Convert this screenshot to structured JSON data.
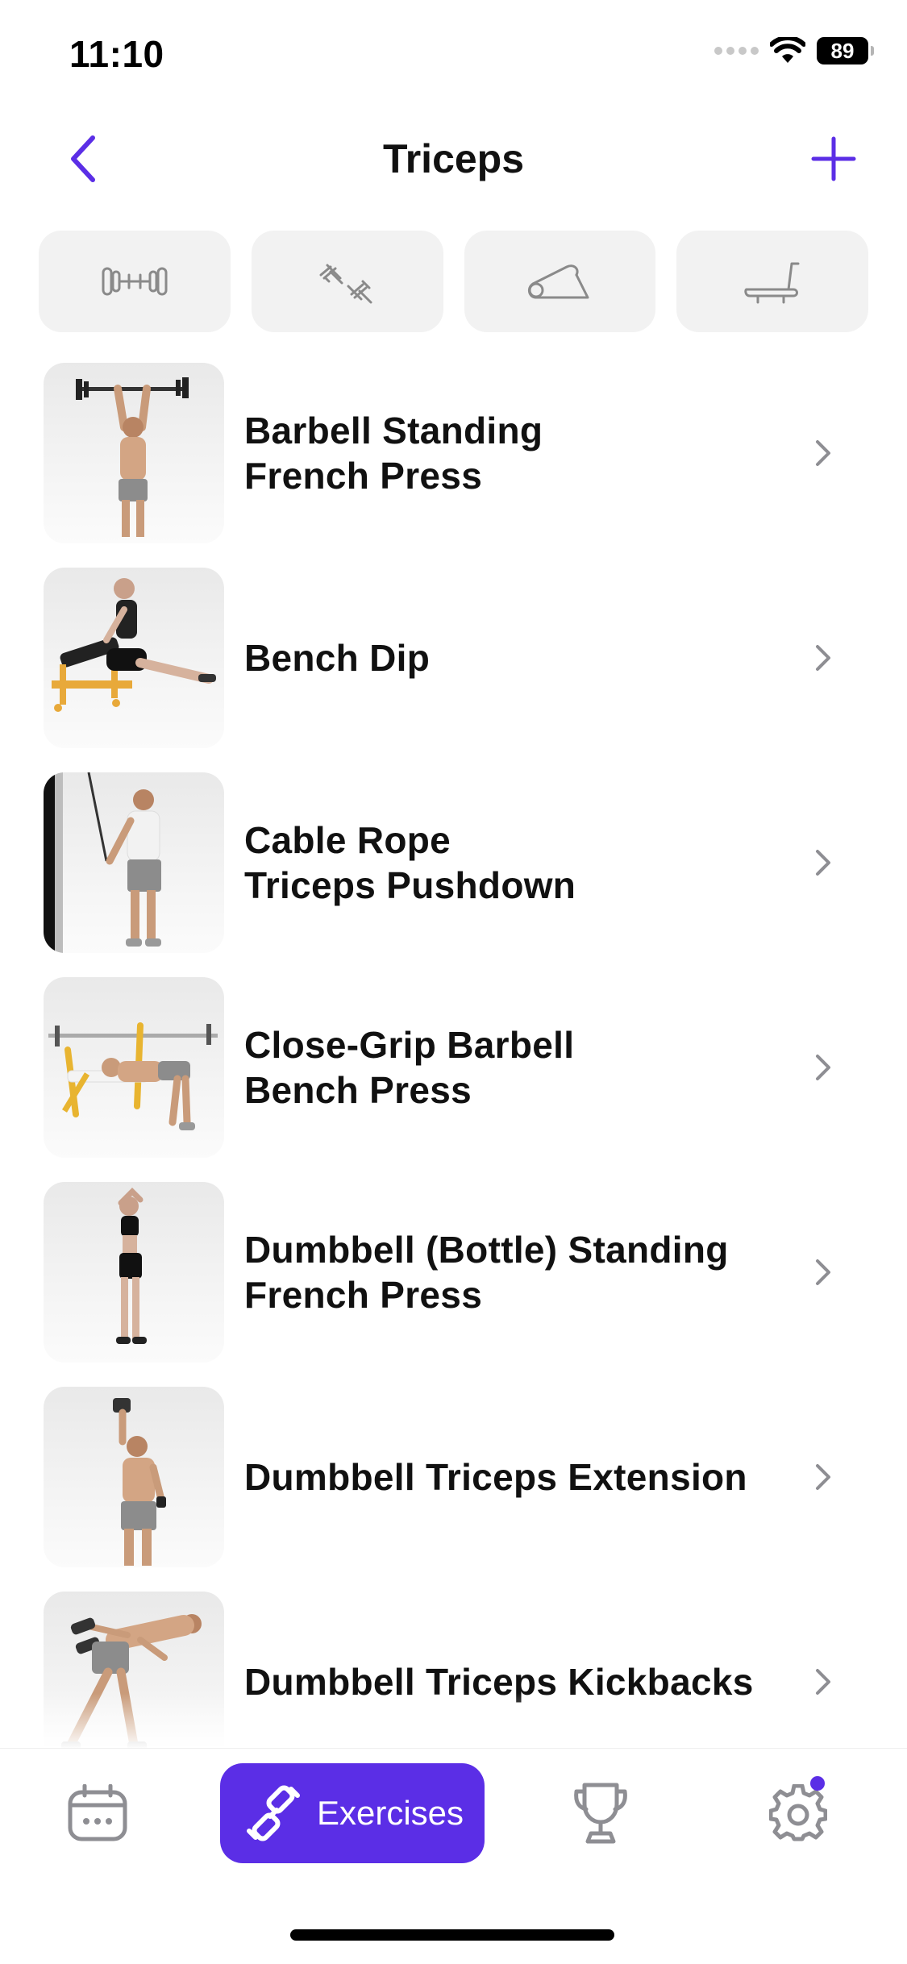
{
  "status_bar": {
    "time": "11:10",
    "battery": "89"
  },
  "nav": {
    "title": "Triceps",
    "back_icon": "chevron-left-icon",
    "add_icon": "plus-icon"
  },
  "filters": [
    {
      "name": "barbell",
      "icon": "barbell-icon"
    },
    {
      "name": "dumbbell",
      "icon": "dumbbell-icon"
    },
    {
      "name": "mat",
      "icon": "mat-icon"
    },
    {
      "name": "machine",
      "icon": "treadmill-icon"
    }
  ],
  "exercises": [
    {
      "label": "Barbell Standing\nFrench Press"
    },
    {
      "label": "Bench Dip"
    },
    {
      "label": "Cable Rope\nTriceps Pushdown"
    },
    {
      "label": "Close-Grip Barbell\nBench Press"
    },
    {
      "label": "Dumbbell (Bottle) Standing\nFrench Press"
    },
    {
      "label": "Dumbbell Triceps Extension"
    },
    {
      "label": "Dumbbell Triceps Kickbacks"
    }
  ],
  "tab_bar": {
    "exercises_label": "Exercises",
    "active": "exercises"
  },
  "colors": {
    "accent": "#5b2ee6",
    "chip_bg": "#f2f2f2",
    "chevron": "#8e8e93"
  }
}
